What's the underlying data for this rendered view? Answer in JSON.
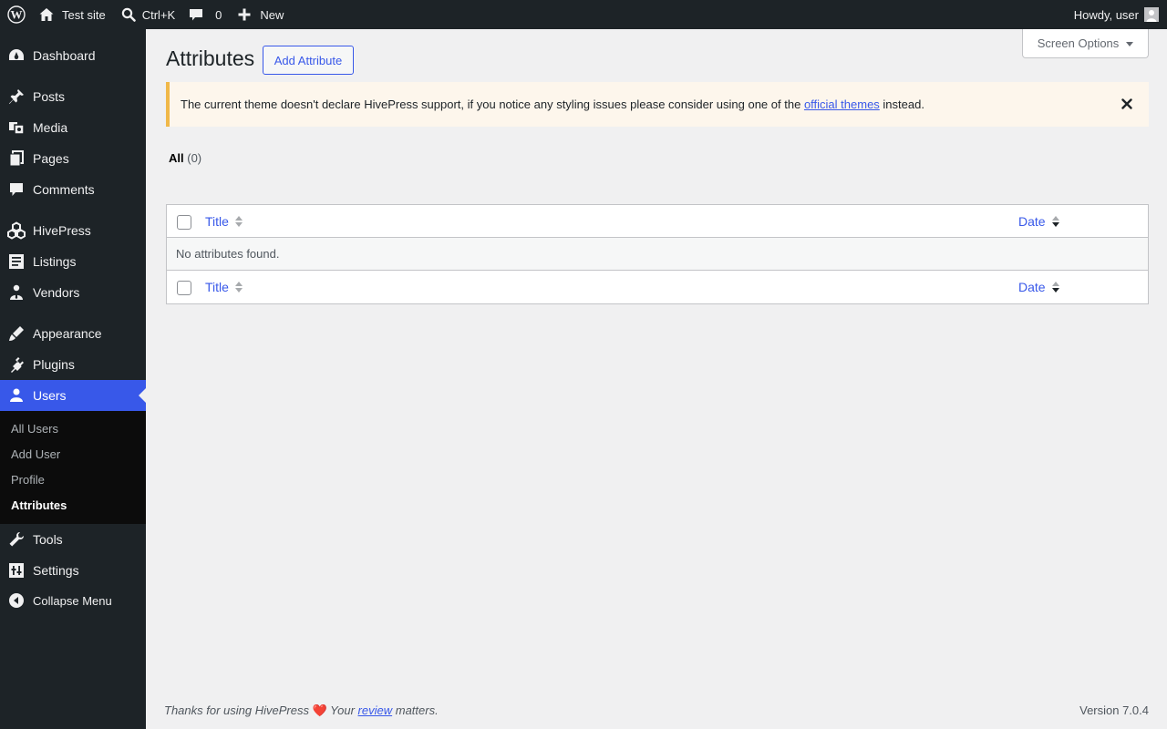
{
  "adminbar": {
    "site_name": "Test site",
    "search_shortcut": "Ctrl+K",
    "comments_count": "0",
    "new_label": "New",
    "greeting": "Howdy, user"
  },
  "sidebar": {
    "items": [
      {
        "label": "Dashboard",
        "icon": "dashboard-icon"
      },
      {
        "label": "Posts",
        "icon": "pin-icon"
      },
      {
        "label": "Media",
        "icon": "media-icon"
      },
      {
        "label": "Pages",
        "icon": "pages-icon"
      },
      {
        "label": "Comments",
        "icon": "comment-icon"
      },
      {
        "label": "HivePress",
        "icon": "hivepress-icon"
      },
      {
        "label": "Listings",
        "icon": "listings-icon"
      },
      {
        "label": "Vendors",
        "icon": "vendors-icon"
      },
      {
        "label": "Appearance",
        "icon": "brush-icon"
      },
      {
        "label": "Plugins",
        "icon": "plugin-icon"
      },
      {
        "label": "Users",
        "icon": "users-icon"
      },
      {
        "label": "Tools",
        "icon": "wrench-icon"
      },
      {
        "label": "Settings",
        "icon": "settings-icon"
      }
    ],
    "submenu": [
      "All Users",
      "Add User",
      "Profile",
      "Attributes"
    ],
    "collapse_label": "Collapse Menu",
    "accent_color": "#3858e9"
  },
  "content": {
    "screen_options": "Screen Options",
    "title": "Attributes",
    "add_button": "Add Attribute",
    "notice": {
      "text_before": "The current theme doesn't declare HivePress support, if you notice any styling issues please consider using one of the",
      "link": "official themes",
      "text_after": "instead."
    },
    "filter": {
      "label": "All",
      "count": "(0)"
    },
    "table": {
      "col_title": "Title",
      "col_date": "Date",
      "empty_message": "No attributes found."
    }
  },
  "footer": {
    "thanks_before": "Thanks for using HivePress",
    "heart": "❤️",
    "your": "Your",
    "review_link": "review",
    "matters": "matters.",
    "version": "Version 7.0.4"
  }
}
